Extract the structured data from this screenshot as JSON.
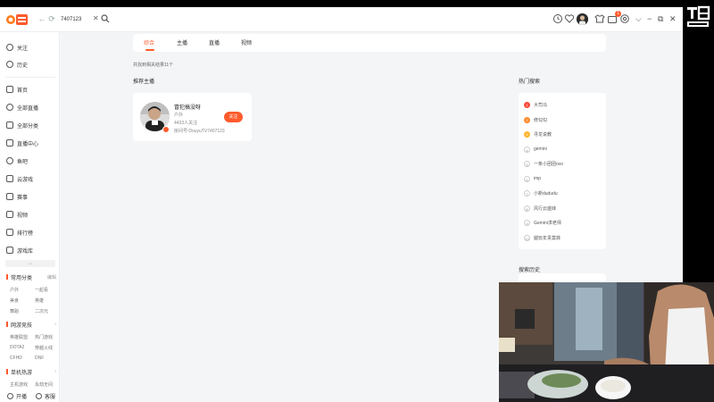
{
  "colors": {
    "accent": "#ff5a2c",
    "rank1": "#ff4b3a",
    "rank2": "#ff8a2c",
    "rank3": "#ffb52c"
  },
  "header": {
    "logo_icon": "douyu-logo",
    "search_value": "7407123",
    "notification_badge": "1"
  },
  "sidebar": {
    "top": [
      {
        "label": "关注",
        "icon": "heart-icon"
      },
      {
        "label": "历史",
        "icon": "clock-icon"
      }
    ],
    "main": [
      {
        "label": "首页",
        "icon": "home-icon"
      },
      {
        "label": "全部直播",
        "icon": "live-icon"
      },
      {
        "label": "全部分类",
        "icon": "grid-icon"
      },
      {
        "label": "直播中心",
        "icon": "center-icon"
      },
      {
        "label": "鱼吧",
        "icon": "fish-icon"
      },
      {
        "label": "云游戏",
        "icon": "cloud-game-icon"
      },
      {
        "label": "赛事",
        "icon": "trophy-icon"
      },
      {
        "label": "视频",
        "icon": "video-icon"
      },
      {
        "label": "排行榜",
        "icon": "rank-icon"
      },
      {
        "label": "游戏库",
        "icon": "library-icon"
      }
    ],
    "sections": [
      {
        "title": "常用分类",
        "extra": "编辑",
        "links": [
          "户外",
          "一起看",
          "美食",
          "英雄",
          "舞蹈",
          "二次元"
        ]
      },
      {
        "title": "网游竞技",
        "extra": "›",
        "links": [
          "英雄联盟",
          "热门游戏",
          "DOTA2",
          "穿越火线",
          "CFHD",
          "DNF"
        ]
      },
      {
        "title": "单机热游",
        "extra": "›",
        "links": [
          "主机游戏",
          "永劫无间"
        ]
      }
    ],
    "footer": [
      {
        "label": "开播",
        "icon": "broadcast-icon"
      },
      {
        "label": "客服",
        "icon": "service-icon"
      }
    ]
  },
  "tabs": [
    "综合",
    "主播",
    "直播",
    "视频"
  ],
  "result_count": "共找到相关结果11个",
  "recommend": {
    "title": "推荐主播",
    "anchor": {
      "name": "冒犯搞没呀",
      "category": "户外",
      "followers": "4433人关注",
      "room": "房间号:DouyuTV7407123",
      "follow_label": "关注"
    }
  },
  "hot": {
    "title": "热门搜索",
    "items": [
      {
        "rank": "1",
        "text": "大司马"
      },
      {
        "rank": "2",
        "text": "修勾勾"
      },
      {
        "rank": "3",
        "text": "寻龙说教"
      },
      {
        "rank": "4",
        "text": "gemini"
      },
      {
        "rank": "5",
        "text": "一条小团团ovo"
      },
      {
        "rank": "6",
        "text": "imp"
      },
      {
        "rank": "7",
        "text": "小新dududu"
      },
      {
        "rank": "8",
        "text": "风行云盛妹"
      },
      {
        "rank": "9",
        "text": "Gemini求老师"
      },
      {
        "rank": "10",
        "text": "腿玩年贵莫菲"
      }
    ]
  },
  "history": {
    "title": "搜索历史"
  },
  "watermark": {
    "icon": "douyu-watermark-logo"
  }
}
